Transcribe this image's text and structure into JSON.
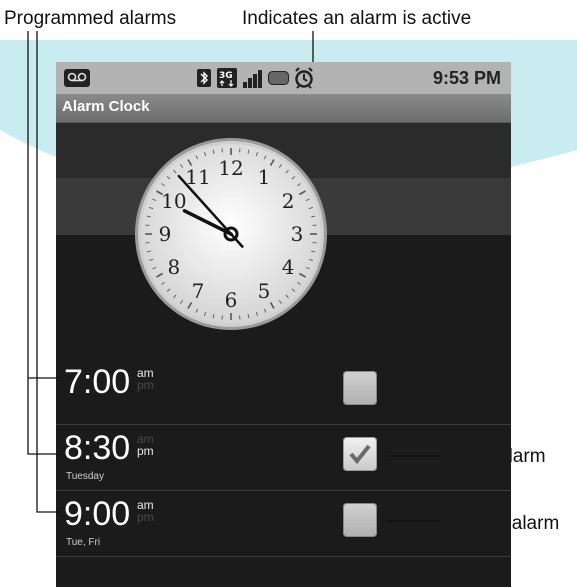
{
  "callouts": {
    "programmed": "Programmed alarms",
    "indicates": "Indicates an alarm is active",
    "active": "Active alarm",
    "inactive": "Inactive alarm"
  },
  "status_bar": {
    "time": "9:53 PM",
    "icons": [
      "voicemail-icon",
      "bluetooth-icon",
      "3g-icon",
      "signal-icon",
      "battery-icon",
      "alarm-icon"
    ]
  },
  "title_bar": {
    "title": "Alarm Clock"
  },
  "clock": {
    "numerals": [
      "12",
      "1",
      "2",
      "3",
      "4",
      "5",
      "6",
      "7",
      "8",
      "9",
      "10",
      "11"
    ],
    "hour": 9,
    "minute": 53
  },
  "alarms": [
    {
      "time": "7:00",
      "am": "am",
      "pm": "pm",
      "period": "am",
      "days": "",
      "enabled": false
    },
    {
      "time": "8:30",
      "am": "am",
      "pm": "pm",
      "period": "pm",
      "days": "Tuesday",
      "enabled": true
    },
    {
      "time": "9:00",
      "am": "am",
      "pm": "pm",
      "period": "am",
      "days": "Tue, Fri",
      "enabled": false
    }
  ],
  "colors": {
    "accent": "#c8ecf0",
    "screen": "#1b1b1b",
    "status_bar": "#b3b3b3",
    "title_bar": "#7a7a7a"
  }
}
